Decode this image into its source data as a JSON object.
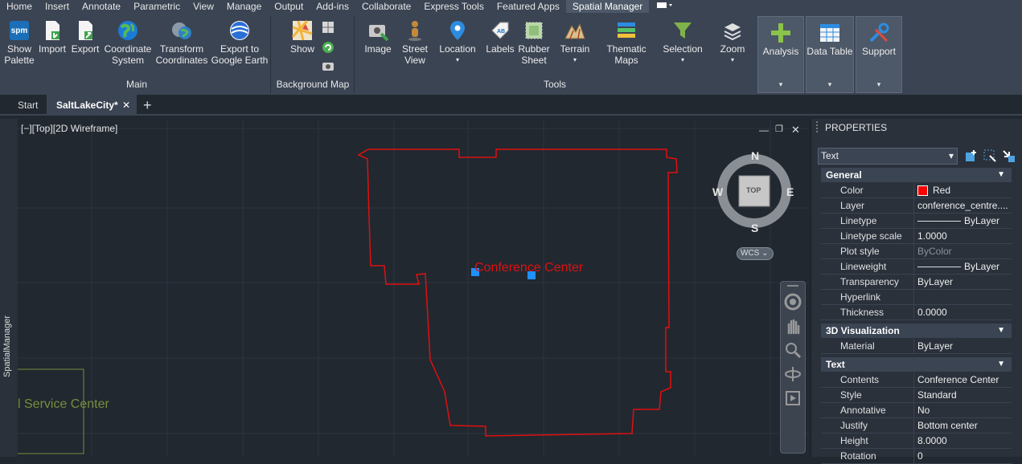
{
  "menu": {
    "items": [
      "Home",
      "Insert",
      "Annotate",
      "Parametric",
      "View",
      "Manage",
      "Output",
      "Add-ins",
      "Collaborate",
      "Express Tools",
      "Featured Apps",
      "Spatial Manager"
    ],
    "active": "Spatial Manager"
  },
  "ribbon": {
    "main": {
      "show_palette": [
        "Show",
        "Palette"
      ],
      "import": "Import",
      "export": "Export",
      "coordinate_system": [
        "Coordinate",
        "System"
      ],
      "transform_coordinates": [
        "Transform",
        "Coordinates"
      ],
      "export_ge": [
        "Export to",
        "Google Earth"
      ],
      "section": "Main"
    },
    "background": {
      "show": "Show",
      "section": "Background Map"
    },
    "tools": {
      "image": "Image",
      "street_view": [
        "Street",
        "View"
      ],
      "location": "Location",
      "labels": "Labels",
      "rubber_sheet": [
        "Rubber",
        "Sheet"
      ],
      "terrain": "Terrain",
      "thematic_maps": [
        "Thematic",
        "Maps"
      ],
      "selection": "Selection",
      "zoom": "Zoom",
      "section": "Tools"
    },
    "analysis": "Analysis",
    "data_table": "Data Table",
    "support": "Support"
  },
  "doc_tabs": {
    "start": "Start",
    "active": "SaltLakeCity*"
  },
  "viewport": {
    "label": "[−][Top][2D Wireframe]",
    "text_conference": "Conference Center",
    "text_service": "l Service Center",
    "sidebar_label": "SpatialManager",
    "compass": {
      "n": "N",
      "s": "S",
      "e": "E",
      "w": "W",
      "top": "TOP",
      "wcs": "WCS"
    },
    "colors": {
      "background": "#212830",
      "boundary": "#e01010",
      "grips": "#1e90ff",
      "service": "#7a8c3a"
    }
  },
  "properties": {
    "title": "PROPERTIES",
    "object_type": "Text",
    "general": {
      "title": "General",
      "rows": [
        {
          "k": "Color",
          "v": "Red"
        },
        {
          "k": "Layer",
          "v": "conference_centre...."
        },
        {
          "k": "Linetype",
          "v": "ByLayer"
        },
        {
          "k": "Linetype scale",
          "v": "1.0000"
        },
        {
          "k": "Plot style",
          "v": "ByColor"
        },
        {
          "k": "Lineweight",
          "v": "ByLayer"
        },
        {
          "k": "Transparency",
          "v": "ByLayer"
        },
        {
          "k": "Hyperlink",
          "v": ""
        },
        {
          "k": "Thickness",
          "v": "0.0000"
        }
      ]
    },
    "viz3d": {
      "title": "3D Visualization",
      "rows": [
        {
          "k": "Material",
          "v": "ByLayer"
        }
      ]
    },
    "text": {
      "title": "Text",
      "rows": [
        {
          "k": "Contents",
          "v": "Conference Center"
        },
        {
          "k": "Style",
          "v": "Standard"
        },
        {
          "k": "Annotative",
          "v": "No"
        },
        {
          "k": "Justify",
          "v": "Bottom center"
        },
        {
          "k": "Height",
          "v": "8.0000"
        },
        {
          "k": "Rotation",
          "v": "0"
        }
      ]
    }
  }
}
